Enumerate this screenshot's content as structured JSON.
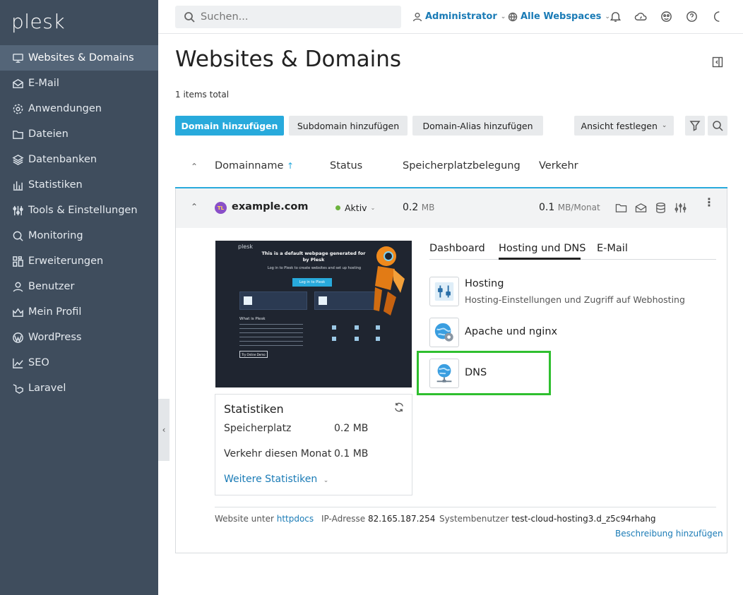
{
  "brand": {
    "logo": "plesk"
  },
  "sidebar": {
    "items": [
      {
        "label": "Websites & Domains",
        "icon": "monitor-icon",
        "active": true
      },
      {
        "label": "E-Mail",
        "icon": "mail-icon"
      },
      {
        "label": "Anwendungen",
        "icon": "gear-icon"
      },
      {
        "label": "Dateien",
        "icon": "folder-icon"
      },
      {
        "label": "Datenbanken",
        "icon": "layers-icon"
      },
      {
        "label": "Statistiken",
        "icon": "bar-chart-icon"
      },
      {
        "label": "Tools & Einstellungen",
        "icon": "sliders-icon"
      },
      {
        "label": "Monitoring",
        "icon": "magnifier-icon"
      },
      {
        "label": "Erweiterungen",
        "icon": "grid-icon"
      },
      {
        "label": "Benutzer",
        "icon": "user-icon"
      },
      {
        "label": "Mein Profil",
        "icon": "profile-icon"
      },
      {
        "label": "WordPress",
        "icon": "wordpress-icon"
      },
      {
        "label": "SEO",
        "icon": "trend-icon"
      },
      {
        "label": "Laravel",
        "icon": "laravel-icon"
      }
    ]
  },
  "topbar": {
    "search_placeholder": "Suchen...",
    "user_label": "Administrator",
    "webspaces_label": "Alle Webspaces"
  },
  "page": {
    "title": "Websites & Domains",
    "items_total": "1 items total"
  },
  "toolbar": {
    "add_domain": "Domain hinzufügen",
    "add_subdomain": "Subdomain hinzufügen",
    "add_alias": "Domain-Alias hinzufügen",
    "view": "Ansicht festlegen"
  },
  "table": {
    "col_domain": "Domainname",
    "col_status": "Status",
    "col_storage": "Speicherplatzbelegung",
    "col_traffic": "Verkehr"
  },
  "domain": {
    "name": "example.com",
    "badge": "TL",
    "status": "Aktiv",
    "storage_value": "0.2",
    "storage_unit": "MB",
    "traffic_value": "0.1",
    "traffic_unit": "MB/Monat"
  },
  "preview": {
    "brand": "plesk",
    "headline": "This is a default webpage generated for by Plesk",
    "subline": "Log in to Plesk to create websites and set up hosting",
    "login_button": "Log in to Plesk",
    "what_is": "What is Plesk",
    "try_button": "Try Online Demo"
  },
  "stats": {
    "title": "Statistiken",
    "storage_label": "Speicherplatz",
    "storage_value": "0.2 MB",
    "traffic_label": "Verkehr diesen Monat",
    "traffic_value": "0.1 MB",
    "more_link": "Weitere Statistiken"
  },
  "tabs": [
    {
      "label": "Dashboard"
    },
    {
      "label": "Hosting und DNS",
      "active": true
    },
    {
      "label": "E-Mail"
    }
  ],
  "services": [
    {
      "title": "Hosting",
      "desc": "Hosting-Einstellungen und Zugriff auf Webhosting",
      "icon": "hosting-sliders-icon"
    },
    {
      "title": "Apache und nginx",
      "desc": "",
      "icon": "apache-globe-gear-icon"
    },
    {
      "title": "DNS",
      "desc": "",
      "icon": "dns-globe-icon"
    }
  ],
  "footer": {
    "website_label": "Website unter",
    "website_link": "httpdocs",
    "ip_label": "IP-Adresse",
    "ip_value": "82.165.187.254",
    "sysuser_label": "Systembenutzer",
    "sysuser_value": "test-cloud-hosting3.d_z5c94rhahg",
    "add_description": "Beschreibung hinzufügen"
  },
  "colors": {
    "accent": "#28aadc",
    "sidebar": "#3f4d5d",
    "highlight": "#2fbf2f",
    "status_active": "#6cb33e"
  }
}
